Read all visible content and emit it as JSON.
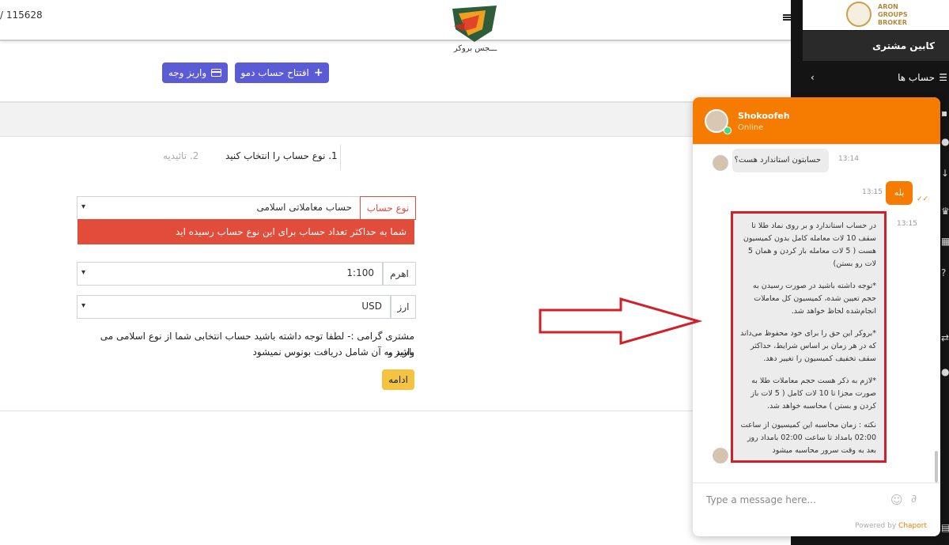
{
  "header": {
    "account_number": "/ 115628",
    "logo_caption": "ـــجس بروکر"
  },
  "actions": {
    "open_demo_label": "افتتاح حساب دمو",
    "deposit_label": "واریز وجه"
  },
  "steps": {
    "step1": "1. نوع حساب را انتخاب کنید",
    "step2": "2. تائیدیه"
  },
  "form": {
    "account_type_label": "نوع حساب",
    "account_type_value": "حساب معاملاتی اسلامی",
    "error_message": "شما به حداکثر تعداد حساب برای این نوع حساب رسیده اید",
    "leverage_label": "اهرم",
    "leverage_value": "1:100",
    "currency_label": "ارز",
    "currency_value": "USD",
    "notice_line1": "مشتری گرامی :- لطفا توجه داشته باشید حساب انتخابی شما از نوع اسلامی می باشد و",
    "notice_line2": "واریز به آن شامل دریافت بونوس نمیشود",
    "continue_label": "ادامه"
  },
  "sidebar": {
    "brand_line1": "ARON",
    "brand_line2": "GROUPS",
    "brand_line3": "BROKER",
    "cabin_title": "کابین مشتری",
    "accounts_label": "حساب ها"
  },
  "chat": {
    "agent_name": "Shokoofeh",
    "agent_status": "Online",
    "messages": {
      "q1_text": "حسابتون استاندارد هست؟",
      "q1_time": "13:14",
      "a1_text": "بله",
      "a1_time": "13:15",
      "answer_time": "13:15"
    },
    "answer": {
      "p1": "در حساب استاندارد و بر روی نماد طلا تا سقف 10 لات معامله کامل بدون کمیسیون هست ( 5 لات معامله باز کردن و همان 5 لات رو بستن)",
      "p2": "*توجه داشته باشید در صورت رسیدن به حجم تعیین شده، کمیسیون کل معاملات انجام‌شده لحاظ خواهد شد.",
      "p3": "*بروکر این حق را برای خود محفوظ می‌داند که در هر زمان بر اساس شرایط، حداکثر سقف تخفیف کمیسیون را تغییر دهد.",
      "p4": "*لازم به ذکر هست حجم معاملات طلا به صورت مجزا تا 10 لات کامل ( 5 لات باز کردن و بستن ) محاسبه خواهد شد.",
      "p5": "نکته : زمان محاسبه این کمیسیون از ساعت 02:00 بامداد تا ساعت 02:00 بامداد روز بعد به وقت سرور محاسبه میشود"
    },
    "input_placeholder": "Type a message here...",
    "powered_prefix": "Powered by",
    "powered_brand": "Chaport"
  },
  "colors": {
    "accent_orange": "#f57c00",
    "button_blue": "#5b5bd6",
    "error_red": "#e24c3b",
    "continue_yellow": "#f5c342",
    "annotation_red": "#d0202a"
  }
}
